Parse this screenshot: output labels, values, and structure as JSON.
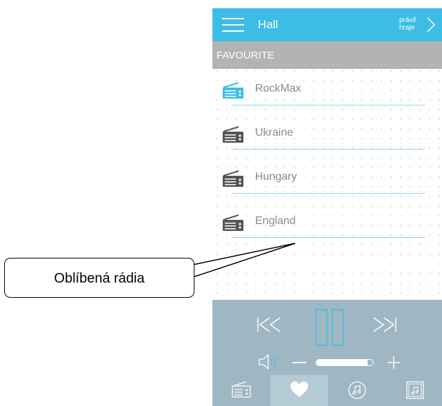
{
  "app": {
    "title": "Hall",
    "now_playing_label": "právě hraje"
  },
  "section": {
    "title": "FAVOURITE"
  },
  "stations": [
    {
      "label": "RockMax",
      "active": true
    },
    {
      "label": "Ukraine",
      "active": false
    },
    {
      "label": "Hungary",
      "active": false
    },
    {
      "label": "England",
      "active": false
    }
  ],
  "player": {
    "volume_level": 0.9
  },
  "tabs": [
    {
      "name": "radio-icon"
    },
    {
      "name": "heart-icon",
      "selected": true
    },
    {
      "name": "music-note-icon"
    },
    {
      "name": "playlist-icon"
    }
  ],
  "annotation": {
    "callout_text": "Oblíbená rádia"
  },
  "colors": {
    "accent": "#3dbde6",
    "header_gray": "#b3b3b3",
    "player_bg": "#9fb7c3",
    "icon_active": "#3dbde6",
    "icon_inactive": "#555555"
  }
}
